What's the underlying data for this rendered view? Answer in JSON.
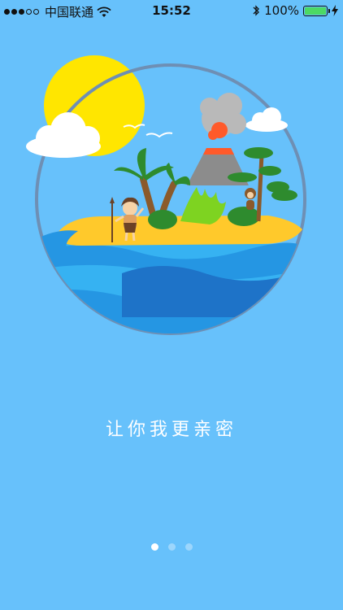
{
  "status_bar": {
    "carrier": "中国联通",
    "time": "15:52",
    "battery_percent": "100%",
    "signal_strength": 3,
    "signal_total": 5
  },
  "onboarding": {
    "tagline": "让你我更亲密",
    "page_count": 3,
    "active_page": 0
  },
  "colors": {
    "background": "#67c1fb",
    "sun": "#ffe600",
    "sand": "#ffc92b",
    "water_dark": "#1e73c8",
    "water_light": "#36b2f2",
    "palm_green": "#2e8b2e",
    "volcano": "#8c8c8c",
    "lava": "#ff5a2a"
  }
}
